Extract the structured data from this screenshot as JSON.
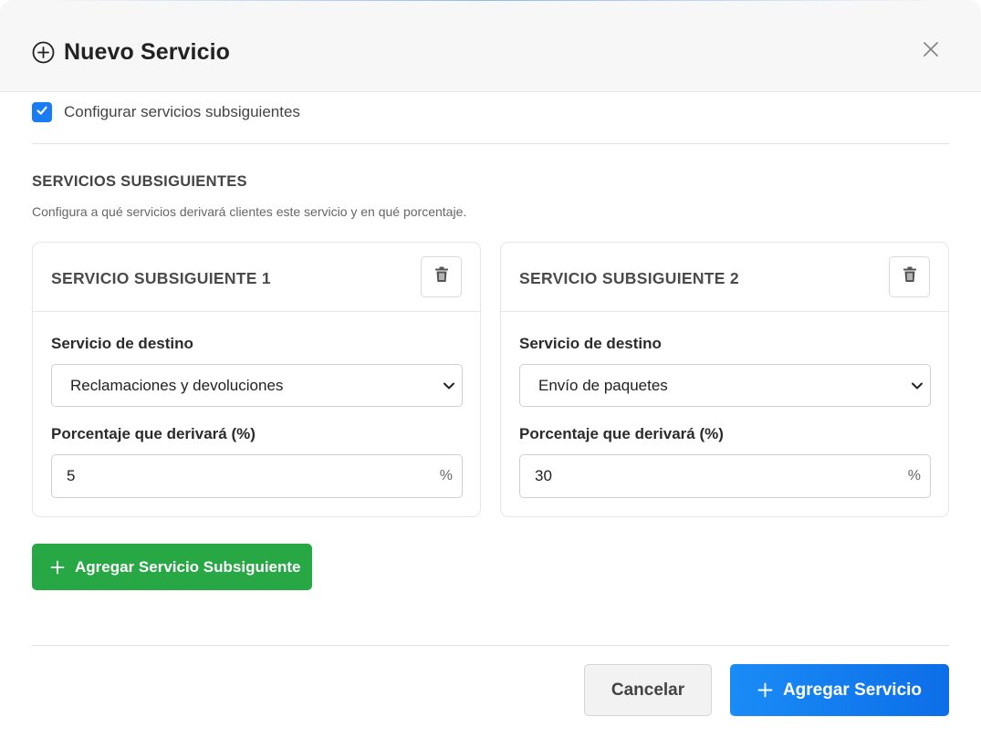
{
  "header": {
    "title": "Nuevo Servicio",
    "icons": {
      "title": "plus-circle-icon",
      "close": "close-icon"
    }
  },
  "config": {
    "checkbox_label": "Configurar servicios subsiguientes",
    "checked": true
  },
  "section": {
    "title": "SERVICIOS SUBSIGUIENTES",
    "description": "Configura a qué servicios derivará clientes este servicio y en qué porcentaje."
  },
  "cards": [
    {
      "title": "SERVICIO SUBSIGUIENTE 1",
      "destination_label": "Servicio de destino",
      "destination_value": "Reclamaciones y devoluciones",
      "percent_label": "Porcentaje que derivará (%)",
      "percent_value": "5",
      "percent_suffix": "%"
    },
    {
      "title": "SERVICIO SUBSIGUIENTE 2",
      "destination_label": "Servicio de destino",
      "destination_value": "Envío de paquetes",
      "percent_label": "Porcentaje que derivará (%)",
      "percent_value": "30",
      "percent_suffix": "%"
    }
  ],
  "buttons": {
    "add_subsequent": "Agregar Servicio Subsiguiente",
    "cancel": "Cancelar",
    "submit": "Agregar Servicio"
  },
  "colors": {
    "primary": "#0d6ee8",
    "success": "#28a745",
    "checkbox": "#1a7cf2"
  }
}
